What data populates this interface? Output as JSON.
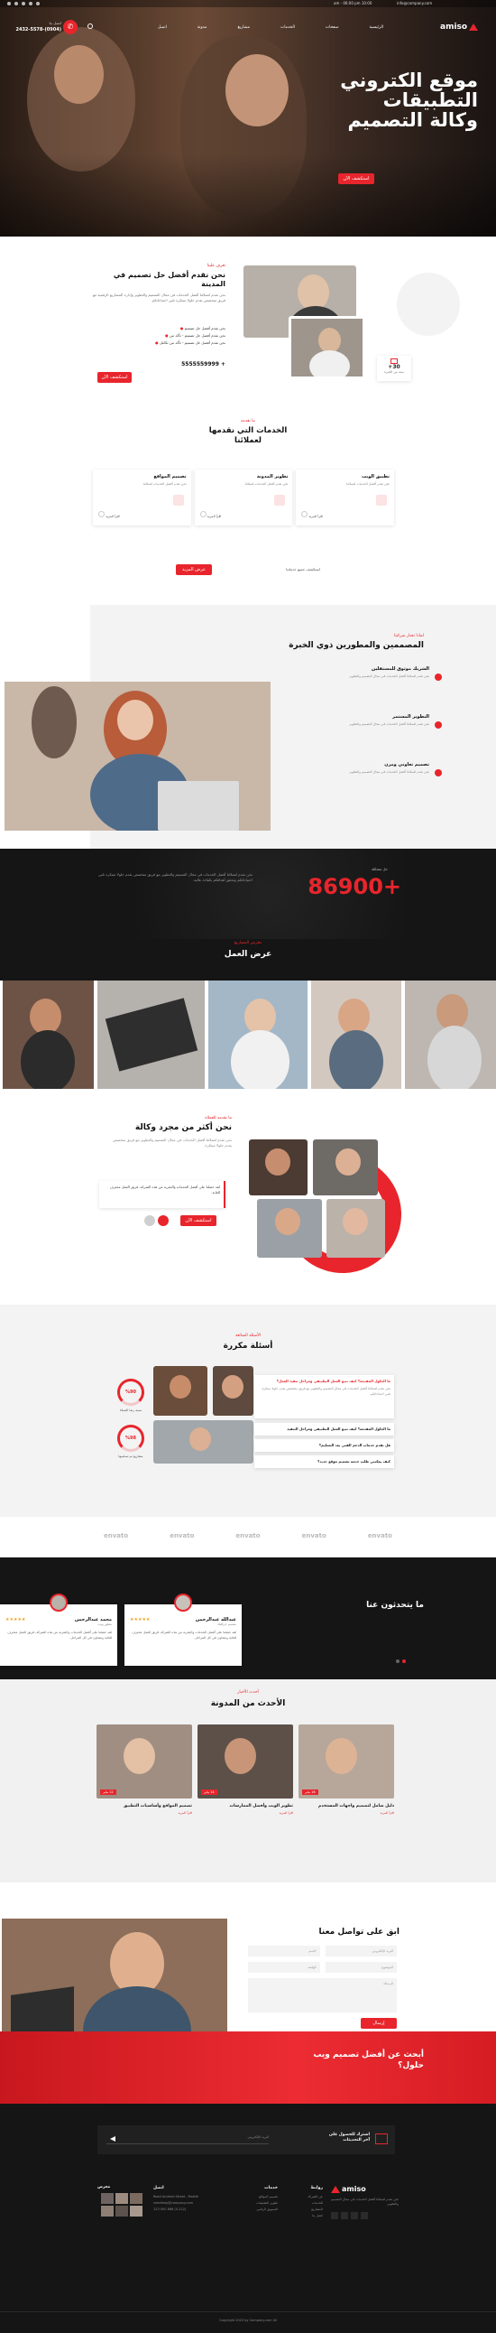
{
  "topbar": {
    "phone": "(0904)-2432-5578",
    "email": "info@company.com",
    "hours": "10:00 am - 06:00 pm"
  },
  "nav": {
    "brand": "amiso",
    "items": [
      "الرئيسية",
      "صفحات",
      "الخدمات",
      "مشاريع",
      "مدونة",
      "اتصل"
    ],
    "cta": "اتصل بنا الآن",
    "phone_label": "اتصل بنا",
    "phone": "(0904)-2432-5578"
  },
  "hero": {
    "title_1": "موقع الكتروني",
    "title_2": "التطبيقات",
    "title_3": "وكالة التصميم",
    "button": "استكشف الآن"
  },
  "about": {
    "eyebrow": "تعرف علينا",
    "title_1": "نحن نقدم أفضل حل تصميم في",
    "title_2": "المدينة",
    "desc": "نحن نقدم لعملائنا أفضل الخدمات في مجال التصميم والتطوير وإدارة المشاريع الرقمية مع فريق متخصص يقدم حلولا مبتكرة تلبي احتياجاتكم.",
    "list": [
      "نحن نقدم أفضل حل تصميم",
      "نحن نقدم أفضل حل تصميم - تأكد من",
      "نحن نقدم أفضل حل تصميم - تأكد من تكامل"
    ],
    "phone": "+ 5555559999",
    "button": "استكشف الآن",
    "stat_num": "30+",
    "stat_label": "سنة من الخبرة"
  },
  "services": {
    "eyebrow": "ما نقدمه",
    "title_1": "الخدمات التي نقدمها",
    "title_2": "لعملائنا",
    "items": [
      {
        "title": "تصميم المواقع",
        "desc": "نحن نقدم أفضل الخدمات لعملائنا",
        "more": "اقرأ المزيد"
      },
      {
        "title": "تطوير المدونة",
        "desc": "نحن نقدم أفضل الخدمات لعملائنا",
        "more": "اقرأ المزيد"
      },
      {
        "title": "تطبيق الويب",
        "desc": "نحن نقدم أفضل الخدمات لعملائنا",
        "more": "اقرأ المزيد"
      }
    ],
    "more_text": "استكشف جميع خدماتنا",
    "more_btn": "عرض المزيد"
  },
  "team": {
    "eyebrow": "لماذا تختار شركتنا",
    "title": "المصممين والمطورين ذوي الخبرة",
    "features": [
      {
        "title": "الشريك موثوق للمستقلين",
        "desc": "نحن نقدم لعملائنا أفضل الخدمات في مجال التصميم والتطوير"
      },
      {
        "title": "التطوير المستمر",
        "desc": "نحن نقدم لعملائنا أفضل الخدمات في مجال التصميم والتطوير"
      },
      {
        "title": "تصميم تعاوني ومرن",
        "desc": "نحن نقدم لعملائنا أفضل الخدمات في مجال التصميم والتطوير"
      }
    ]
  },
  "counter": {
    "eyebrow": "حل مشكلة",
    "number": "+86900",
    "desc": "نحن نقدم لعملائنا أفضل الخدمات في مجال التصميم والتطوير مع فريق متخصص يقدم حلولا مبتكرة تلبي احتياجاتكم وتحقق أهدافكم بكفاءة عالية."
  },
  "portfolio": {
    "eyebrow": "معرض المشاريع",
    "title": "عرض العمل"
  },
  "agency": {
    "eyebrow": "ما نقدمه للعملاء",
    "title": "نحن أكثر من مجرد وكالة",
    "desc": "نحن نقدم لعملائنا أفضل الخدمات في مجال التصميم والتطوير مع فريق متخصص يقدم حلولا مبتكرة.",
    "quote": "لقد حصلنا على أفضل الخدمات والتجربة من هذه الشركة، فريق العمل محترف للغاية.",
    "button": "استكشف الآن"
  },
  "faq": {
    "eyebrow": "الأسئلة الشائعة",
    "title": "أسئلة مكررة",
    "active_q": "ما الحلول المقدمة؟ كيف نتبع العمل التطبيقي ومراحل تنفيذ العمل؟",
    "answer": "نحن نقدم لعملائنا أفضل الخدمات في مجال التصميم والتطوير مع فريق متخصص يقدم حلولا مبتكرة تلبي احتياجاتكم.",
    "questions": [
      "ما الحلول المقدمة؟ كيف نتبع العمل التطبيقي ومراحل التنفيذ",
      "هل نقدم خدمات الدعم الفني بعد التسليم؟",
      "كيف يمكنني طلب خدمة تصميم موقع جديد؟"
    ],
    "stats": [
      {
        "num": "%90",
        "label": "نسبة رضا العملاء"
      },
      {
        "num": "%98",
        "label": "مشاريع تم تسليمها"
      }
    ]
  },
  "brands": [
    "envato",
    "envato",
    "envato",
    "envato",
    "envato"
  ],
  "testimonials": {
    "title": "ما يتحدثون عنا",
    "items": [
      {
        "name": "عبدالله عبدالرحمن",
        "role": "مصمم جرافيك",
        "text": "لقد حصلنا على أفضل الخدمات والتجربة من هذه الشركة، فريق العمل محترف للغاية ومتعاون في كل المراحل.",
        "stars": "★★★★★"
      },
      {
        "name": "محمد عبدالرحمن",
        "role": "مطور ويب",
        "text": "لقد حصلنا على أفضل الخدمات والتجربة من هذه الشركة، فريق العمل محترف للغاية ومتعاون في كل المراحل.",
        "stars": "★★★★★"
      }
    ]
  },
  "blog": {
    "eyebrow": "أحدث الأخبار",
    "title": "الأحدث من المدونة",
    "posts": [
      {
        "title": "تصميم المواقع وأساسيات التطبيق",
        "date": "12 يناير",
        "more": "اقرأ المزيد"
      },
      {
        "title": "تطوير الويب وأفضل الممارسات",
        "date": "14 يناير",
        "more": "اقرأ المزيد"
      },
      {
        "title": "دليل شامل لتصميم واجهات المستخدم",
        "date": "16 يناير",
        "more": "اقرأ المزيد"
      }
    ]
  },
  "contact": {
    "title": "ابق على تواصل معنا",
    "fields": [
      "الاسم",
      "البريد الإلكتروني",
      "الهاتف",
      "الموضوع"
    ],
    "message": "الرسالة",
    "button": "إرسال"
  },
  "cta": {
    "title_1": "أبحث عن أفضل تصميم ويب",
    "title_2": "حلول؟",
    "button": "اتصل بنا"
  },
  "newsletter": {
    "title_1": "اشترك للحصول على",
    "title_2": "آخر التحديثات",
    "placeholder": "البريد الإلكتروني"
  },
  "footer": {
    "brand": "amiso",
    "about": "نحن نقدم لعملائنا أفضل الخدمات في مجال التصميم والتطوير.",
    "col2_title": "روابط",
    "links": [
      "عن الشركة",
      "الخدمات",
      "المشاريع",
      "اتصل بنا"
    ],
    "col3_title": "خدمات",
    "services": [
      "تصميم المواقع",
      "تطوير التطبيقات",
      "التسويق الرقمي"
    ],
    "col4_title": "اتصل",
    "address": "Road Android Street , Mobile",
    "email": "needhelp@company.com",
    "phone": "(0-222) 888 000 123",
    "col5_title": "معرض",
    "copyright": "Copyright 2023 by Company.com All"
  },
  "colors": {
    "accent": "#e8252c",
    "dark": "#151515"
  }
}
